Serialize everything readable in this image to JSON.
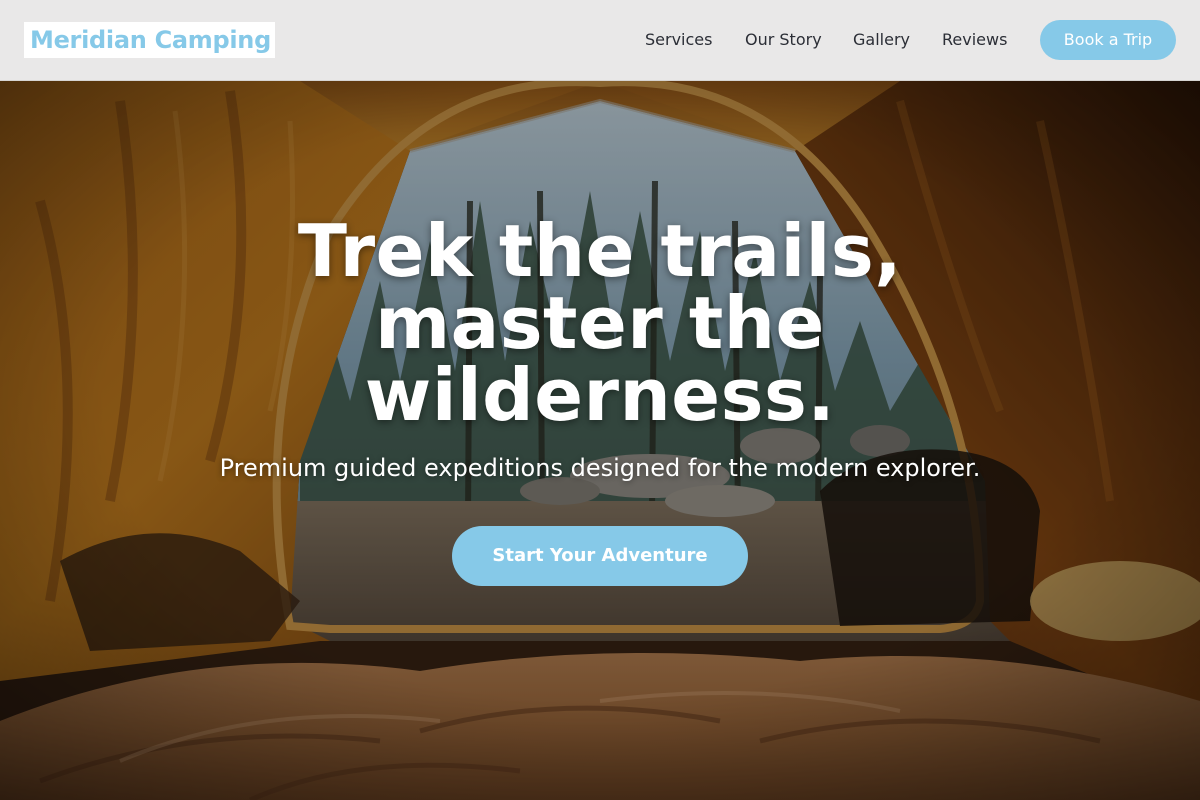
{
  "header": {
    "logo_text": "Meridian Camping",
    "nav": {
      "services": "Services",
      "our_story": "Our Story",
      "gallery": "Gallery",
      "reviews": "Reviews"
    },
    "book_button": "Book a Trip"
  },
  "hero": {
    "headline": "Trek the trails, master the wilderness.",
    "subheadline": "Premium guided expeditions designed for the modern explorer.",
    "cta_button": "Start Your Adventure",
    "background_image": "view from inside an orange tent looking out at a pine forest with rocks, sleeping bag in foreground"
  },
  "colors": {
    "accent": "#86c9e8",
    "header_bg": "#e9e8e8",
    "nav_text": "#2b2e36",
    "hero_text": "#ffffff"
  }
}
